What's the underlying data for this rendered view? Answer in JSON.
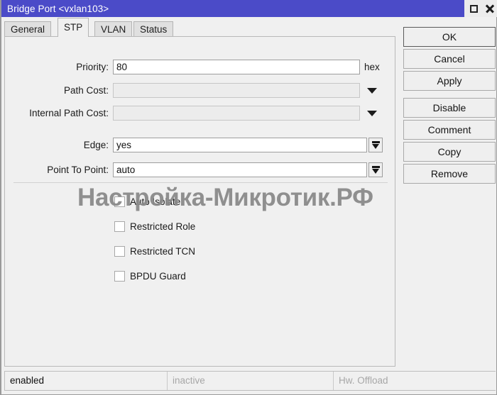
{
  "window": {
    "title": "Bridge Port <vxlan103>",
    "title_bg": "#4b4bc8",
    "controls": {
      "maximize": "maximize-icon",
      "close": "close-icon"
    }
  },
  "tabs": [
    {
      "label": "General",
      "active": false
    },
    {
      "label": "STP",
      "active": true
    },
    {
      "label": "VLAN",
      "active": false
    },
    {
      "label": "Status",
      "active": false
    }
  ],
  "form": {
    "fields": [
      {
        "label": "Priority:",
        "value": "80",
        "suffix": "hex",
        "disabled": false,
        "control": "text"
      },
      {
        "label": "Path Cost:",
        "value": "",
        "suffix": "",
        "disabled": true,
        "control": "combo-bare"
      },
      {
        "label": "Internal Path Cost:",
        "value": "",
        "suffix": "",
        "disabled": true,
        "control": "combo-bare"
      },
      {
        "label": "Edge:",
        "value": "yes",
        "suffix": "",
        "disabled": false,
        "control": "combo-button"
      },
      {
        "label": "Point To Point:",
        "value": "auto",
        "suffix": "",
        "disabled": false,
        "control": "combo-button"
      }
    ],
    "checkboxes": [
      {
        "label": "Auto Isolate",
        "checked": false
      },
      {
        "label": "Restricted Role",
        "checked": false
      },
      {
        "label": "Restricted TCN",
        "checked": false
      },
      {
        "label": "BPDU Guard",
        "checked": false
      }
    ]
  },
  "watermark": {
    "text": "Настройка-Микротик.РФ",
    "color": "#8a8a8a"
  },
  "buttons": [
    {
      "label": "OK",
      "primary": true,
      "gap": false
    },
    {
      "label": "Cancel",
      "primary": false,
      "gap": false
    },
    {
      "label": "Apply",
      "primary": false,
      "gap": false
    },
    {
      "label": "Disable",
      "primary": false,
      "gap": true
    },
    {
      "label": "Comment",
      "primary": false,
      "gap": false
    },
    {
      "label": "Copy",
      "primary": false,
      "gap": false
    },
    {
      "label": "Remove",
      "primary": false,
      "gap": false
    }
  ],
  "statusbar": {
    "enabled": "enabled",
    "inactive": "inactive",
    "hw_offload": "Hw. Offload"
  }
}
